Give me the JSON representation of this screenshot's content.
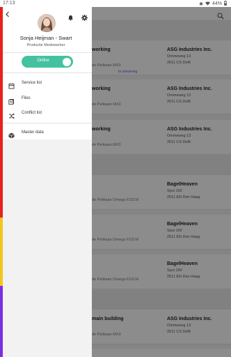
{
  "status_bar": {
    "time": "17:13",
    "battery": "44%"
  },
  "drawer": {
    "user": {
      "name": "Sonja Heijman - Swart",
      "role": "Productie Medewerker"
    },
    "status_toggle": {
      "label": "Online",
      "state": "on"
    },
    "menu": [
      {
        "label": "Service list",
        "icon": "service-list-icon"
      },
      {
        "label": "Files",
        "icon": "files-icon"
      },
      {
        "label": "Conflict list",
        "icon": "conflict-icon"
      },
      {
        "label": "Master data",
        "icon": "cube-icon"
      }
    ]
  },
  "cards": [
    {
      "title": "working",
      "subtitle": "de Pelikaan MX3",
      "tag": "In uitvoering",
      "customer": "ASG Industries Inc.",
      "street": "Ommeweg 13",
      "city": "2611 CS Delft"
    },
    {
      "title": "working",
      "subtitle": "de Pelikaan MX3",
      "tag": "",
      "customer": "ASG Industries Inc.",
      "street": "Ommeweg 13",
      "city": "2611 CS Delft"
    },
    {
      "title": "working",
      "subtitle": "de Pelikaan MX3",
      "tag": "",
      "customer": "ASG Industries Inc.",
      "street": "Ommeweg 13",
      "city": "2611 CS Delft"
    },
    {
      "title": "",
      "subtitle": "de Pelikaan Omega F22LM",
      "tag": "",
      "customer": "BagelHeaven",
      "street": "Spui 160",
      "city": "2511 EN Den Haag"
    },
    {
      "title": "",
      "subtitle": "de Pelikaan Omega F22LM",
      "tag": "",
      "customer": "BagelHeaven",
      "street": "Spui 160",
      "city": "2511 EN Den Haag"
    },
    {
      "title": "",
      "subtitle": "de Pelikaan Omega F22LM",
      "tag": "",
      "customer": "BagelHeaven",
      "street": "Spui 160",
      "city": "2511 EN Den Haag"
    },
    {
      "title": "main building",
      "subtitle": "de Pelikaan MX3",
      "tag": "",
      "customer": "ASG Industries Inc.",
      "street": "Ommeweg 13",
      "city": "2611 CS Delft"
    }
  ],
  "colors": {
    "accent": "#44c2a0",
    "strip_red": "#e8201f",
    "strip_yellow": "#f2c61e",
    "strip_purple": "#7b2fe0"
  }
}
